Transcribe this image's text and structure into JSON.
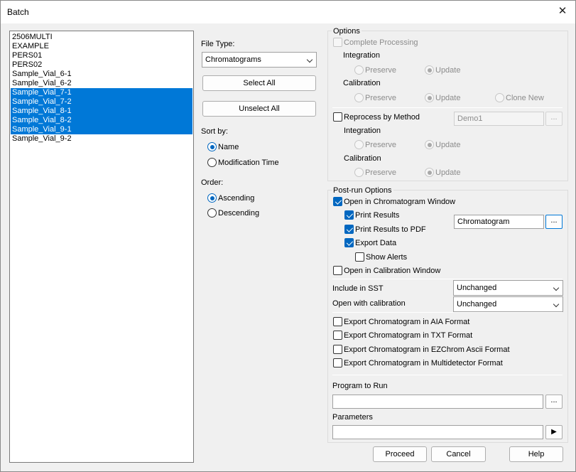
{
  "window": {
    "title": "Batch",
    "close_glyph": "✕"
  },
  "files": {
    "items": [
      {
        "label": "2506MULTI",
        "selected": false
      },
      {
        "label": "EXAMPLE",
        "selected": false
      },
      {
        "label": "PERS01",
        "selected": false
      },
      {
        "label": "PERS02",
        "selected": false
      },
      {
        "label": "Sample_Vial_6-1",
        "selected": false
      },
      {
        "label": "Sample_Vial_6-2",
        "selected": false
      },
      {
        "label": "Sample_Vial_7-1",
        "selected": true
      },
      {
        "label": "Sample_Vial_7-2",
        "selected": true
      },
      {
        "label": "Sample_Vial_8-1",
        "selected": true
      },
      {
        "label": "Sample_Vial_8-2",
        "selected": true
      },
      {
        "label": "Sample_Vial_9-1",
        "selected": true
      },
      {
        "label": "Sample_Vial_9-2",
        "selected": false
      }
    ]
  },
  "middle": {
    "file_type_label": "File Type:",
    "file_type_value": "Chromatograms",
    "select_all": "Select All",
    "unselect_all": "Unselect All",
    "sort_by_label": "Sort by:",
    "sort_name": "Name",
    "sort_mod_time": "Modification Time",
    "order_label": "Order:",
    "ascending": "Ascending",
    "descending": "Descending"
  },
  "options": {
    "title": "Options",
    "complete_processing": "Complete Processing",
    "integration": "Integration",
    "calibration": "Calibration",
    "preserve": "Preserve",
    "update": "Update",
    "clone_new": "Clone New",
    "reprocess_by_method": "Reprocess by Method",
    "method_value": "Demo1",
    "browse": "..."
  },
  "postrun": {
    "title": "Post-run Options",
    "open_chrom_window": "Open in Chromatogram Window",
    "print_results": "Print Results",
    "print_results_pdf": "Print Results to PDF",
    "export_data": "Export Data",
    "show_alerts": "Show Alerts",
    "report_value": "Chromatogram",
    "open_cal_window": "Open in Calibration Window",
    "include_sst_label": "Include in SST",
    "include_sst_value": "Unchanged",
    "open_with_cal_label": "Open with calibration",
    "open_with_cal_value": "Unchanged",
    "export_aia": "Export Chromatogram in AIA Format",
    "export_txt": "Export Chromatogram in TXT Format",
    "export_ezchrom": "Export Chromatogram in EZChrom Ascii Format",
    "export_multidet": "Export Chromatogram in Multidetector Format",
    "program_to_run_label": "Program to Run",
    "program_to_run_value": "",
    "parameters_label": "Parameters",
    "parameters_value": "",
    "browse": "...",
    "play_glyph": "▶"
  },
  "footer": {
    "proceed": "Proceed",
    "cancel": "Cancel",
    "help": "Help"
  }
}
